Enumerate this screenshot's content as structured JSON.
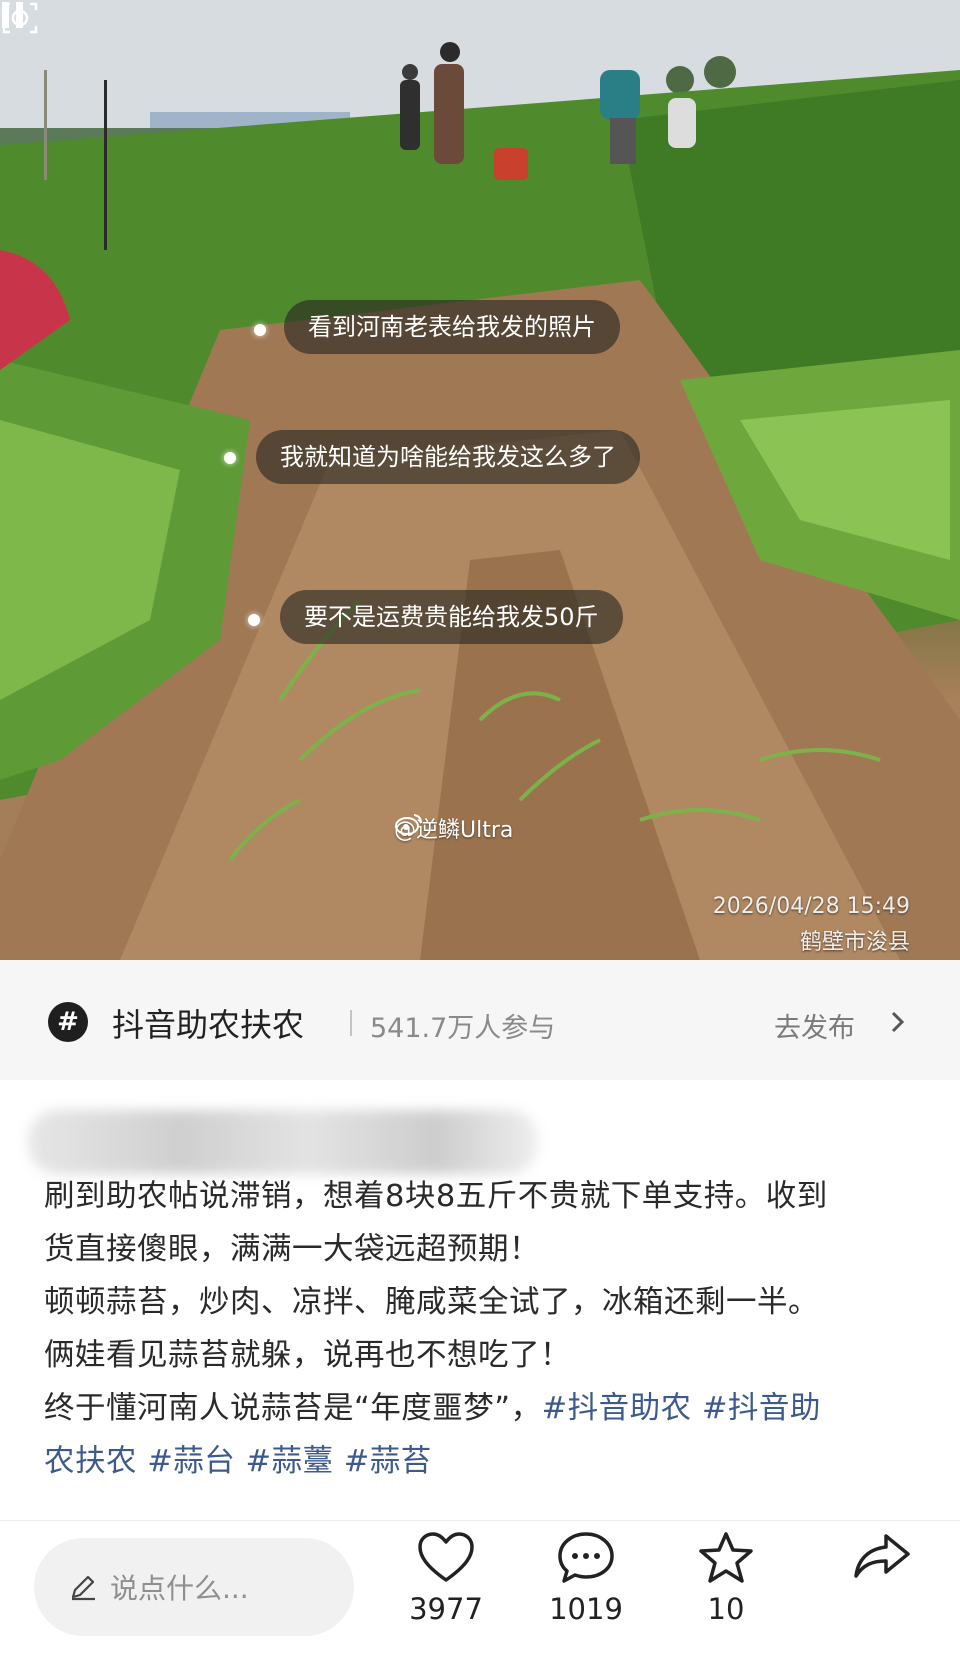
{
  "photo": {
    "captions": [
      "看到河南老表给我发的照片",
      "我就知道为啥能给我发这么多了",
      "要不是运费贵能给我发50斤"
    ],
    "watermark": "@逆鳞Ultra",
    "timestamp": "2026/04/28 15:49",
    "location": "鹤壁市浚县"
  },
  "topic": {
    "icon": "#",
    "name": "抖音助农扶农",
    "participants": "541.7万人参与",
    "action": "去发布"
  },
  "post": {
    "lines": [
      "刷到助农帖说滞销，想着8块8五斤不贵就下单支持。收到",
      "货直接傻眼，满满一大袋远超预期！",
      "顿顿蒜苔，炒肉、凉拌、腌咸菜全试了，冰箱还剩一半。",
      "俩娃看见蒜苔就躲，说再也不想吃了！"
    ],
    "line5_text": "终于懂河南人说蒜苔是“年度噩梦”，",
    "line5_tag": "#抖音助农",
    "line5_tag_b": "#抖音助",
    "line6_tag_a": "农扶农",
    "line6_tags": [
      "#蒜台",
      "#蒜薹",
      "#蒜苔"
    ]
  },
  "actions": {
    "comment_placeholder": "说点什么...",
    "like_count": "3977",
    "comment_count": "1019",
    "favorite_count": "10"
  },
  "colors": {
    "hashtag": "#3e5a8c",
    "bubble": "rgba(40,38,34,0.62)"
  }
}
